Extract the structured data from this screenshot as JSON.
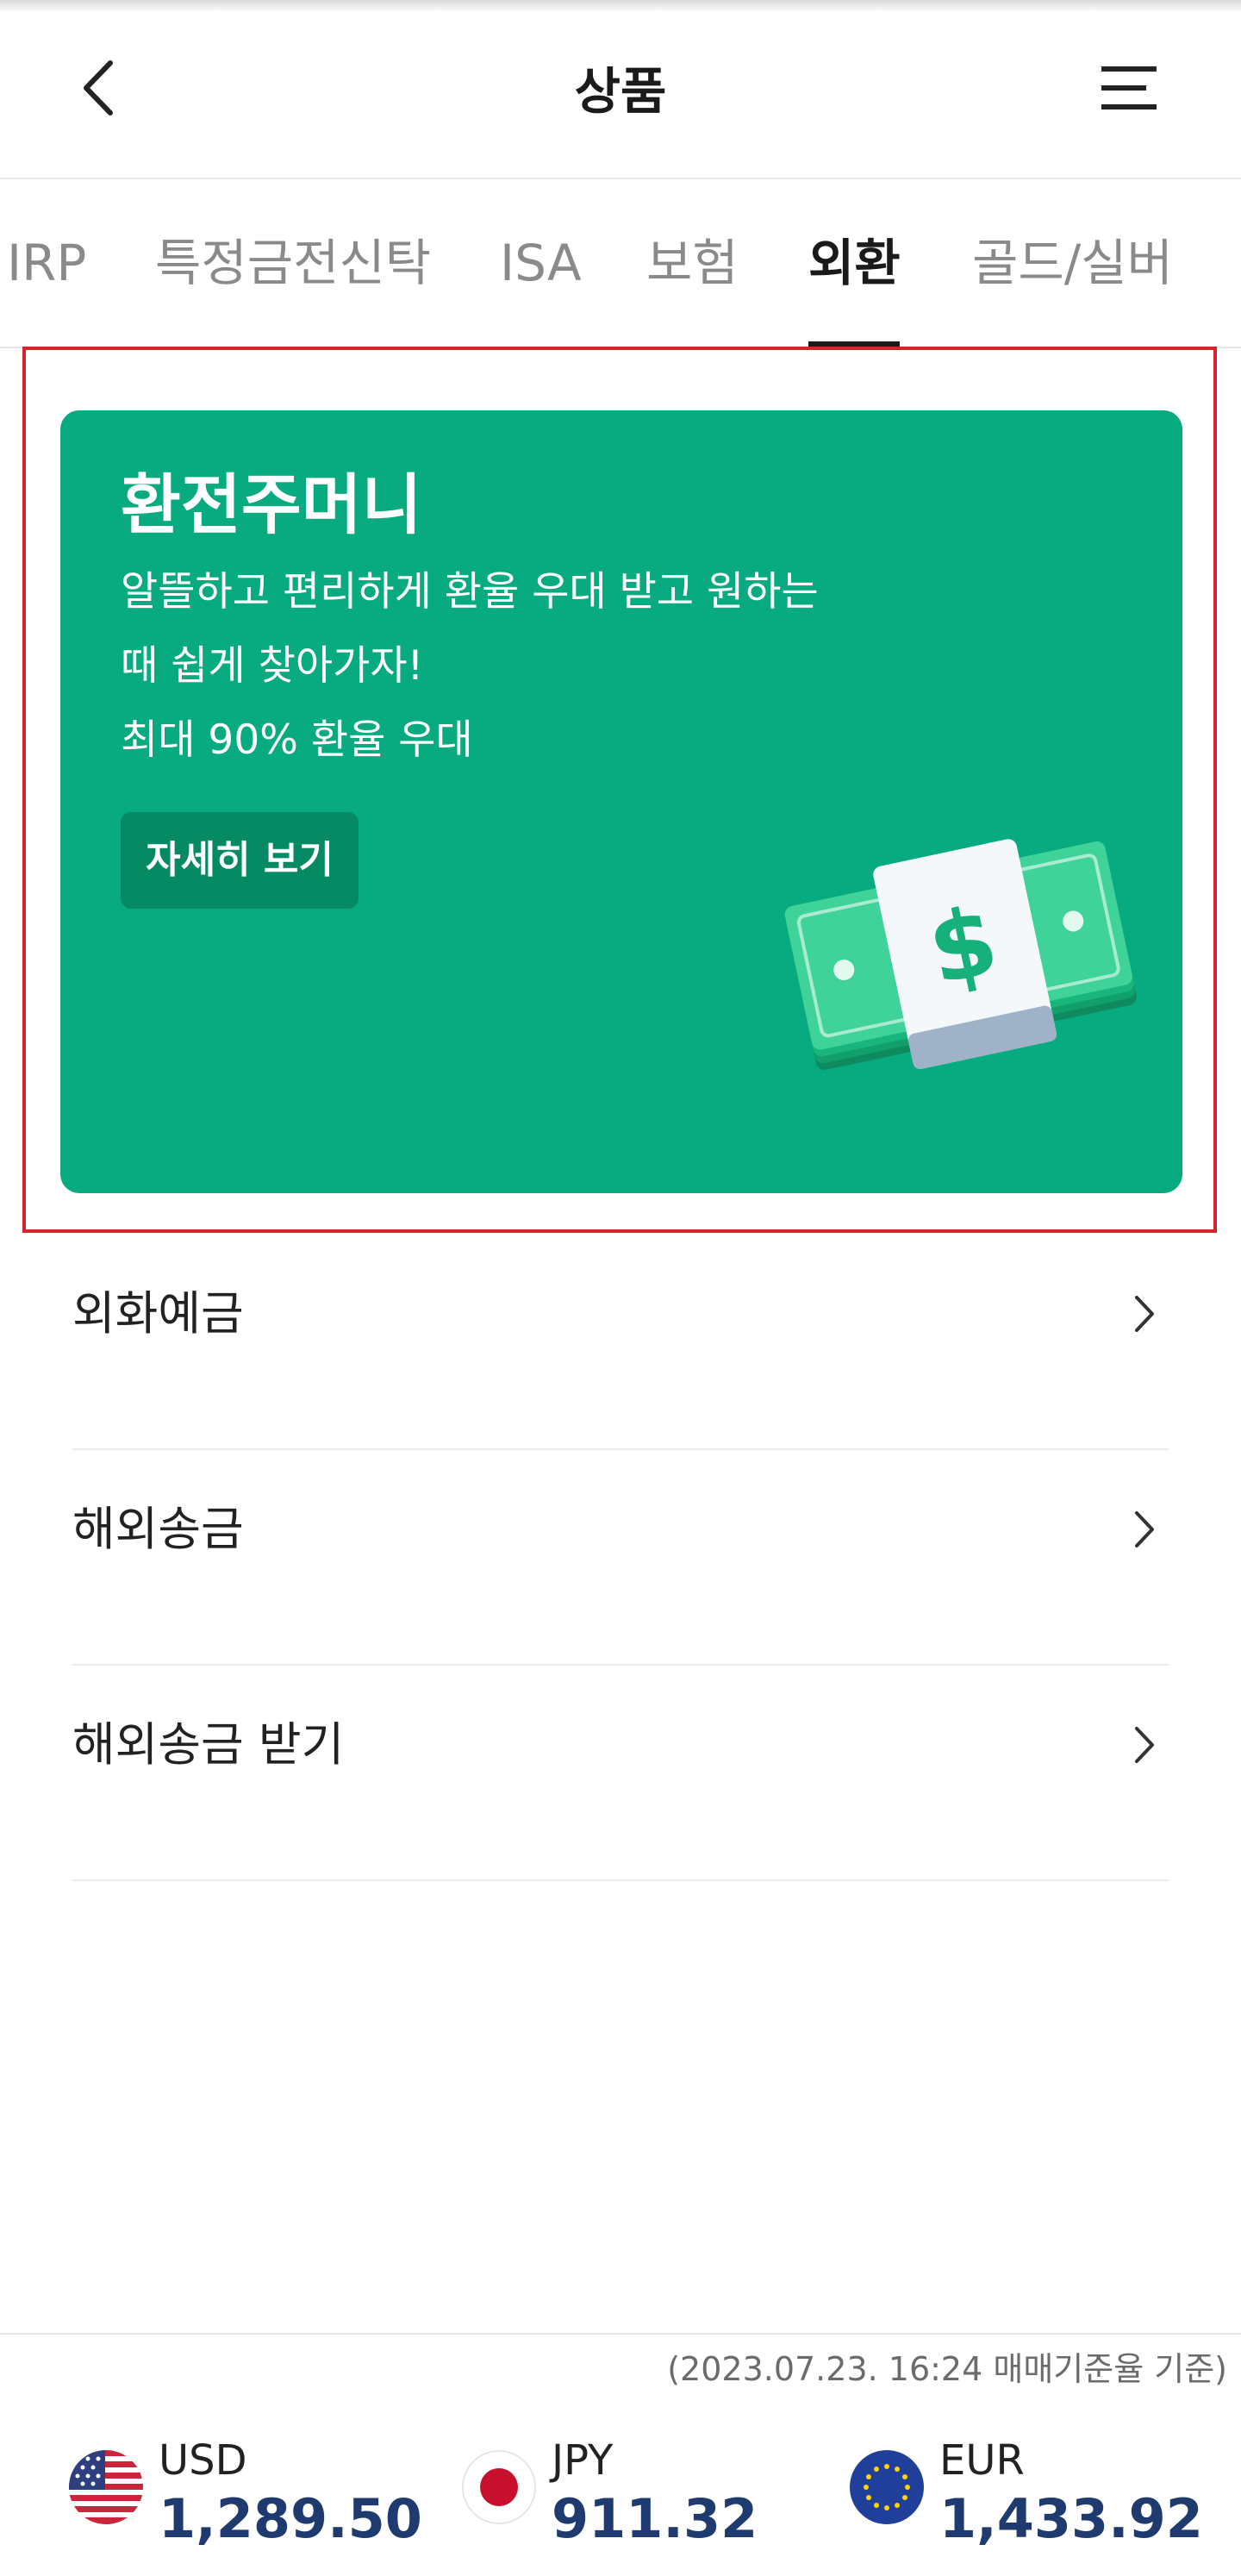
{
  "header": {
    "title": "상품"
  },
  "tabs": [
    {
      "label": "IRP"
    },
    {
      "label": "특정금전신탁"
    },
    {
      "label": "ISA"
    },
    {
      "label": "보험"
    },
    {
      "label": "외환"
    },
    {
      "label": "골드/실버"
    }
  ],
  "active_tab": "외환",
  "banner": {
    "title": "환전주머니",
    "lines": [
      "알뜰하고 편리하게 환율 우대 받고 원하는",
      "때 쉽게 찾아가자!",
      "최대 90% 환율 우대"
    ],
    "button_label": "자세히 보기",
    "background_color": "#07ab7f",
    "illustration_icon": "cash-dollar-icon"
  },
  "list": [
    {
      "label": "외화예금"
    },
    {
      "label": "해외송금"
    },
    {
      "label": "해외송금 받기"
    }
  ],
  "rates": {
    "basis": "(2023.07.23. 16:24 매매기준율 기준)",
    "items": [
      {
        "code": "USD",
        "value": "1,289.50",
        "flag": "us-flag-icon"
      },
      {
        "code": "JPY",
        "value": "911.32",
        "flag": "jp-flag-icon"
      },
      {
        "code": "EUR",
        "value": "1,433.92",
        "flag": "eu-flag-icon"
      }
    ],
    "value_color": "#1e3a6e"
  },
  "highlight_color": "#d8232a"
}
